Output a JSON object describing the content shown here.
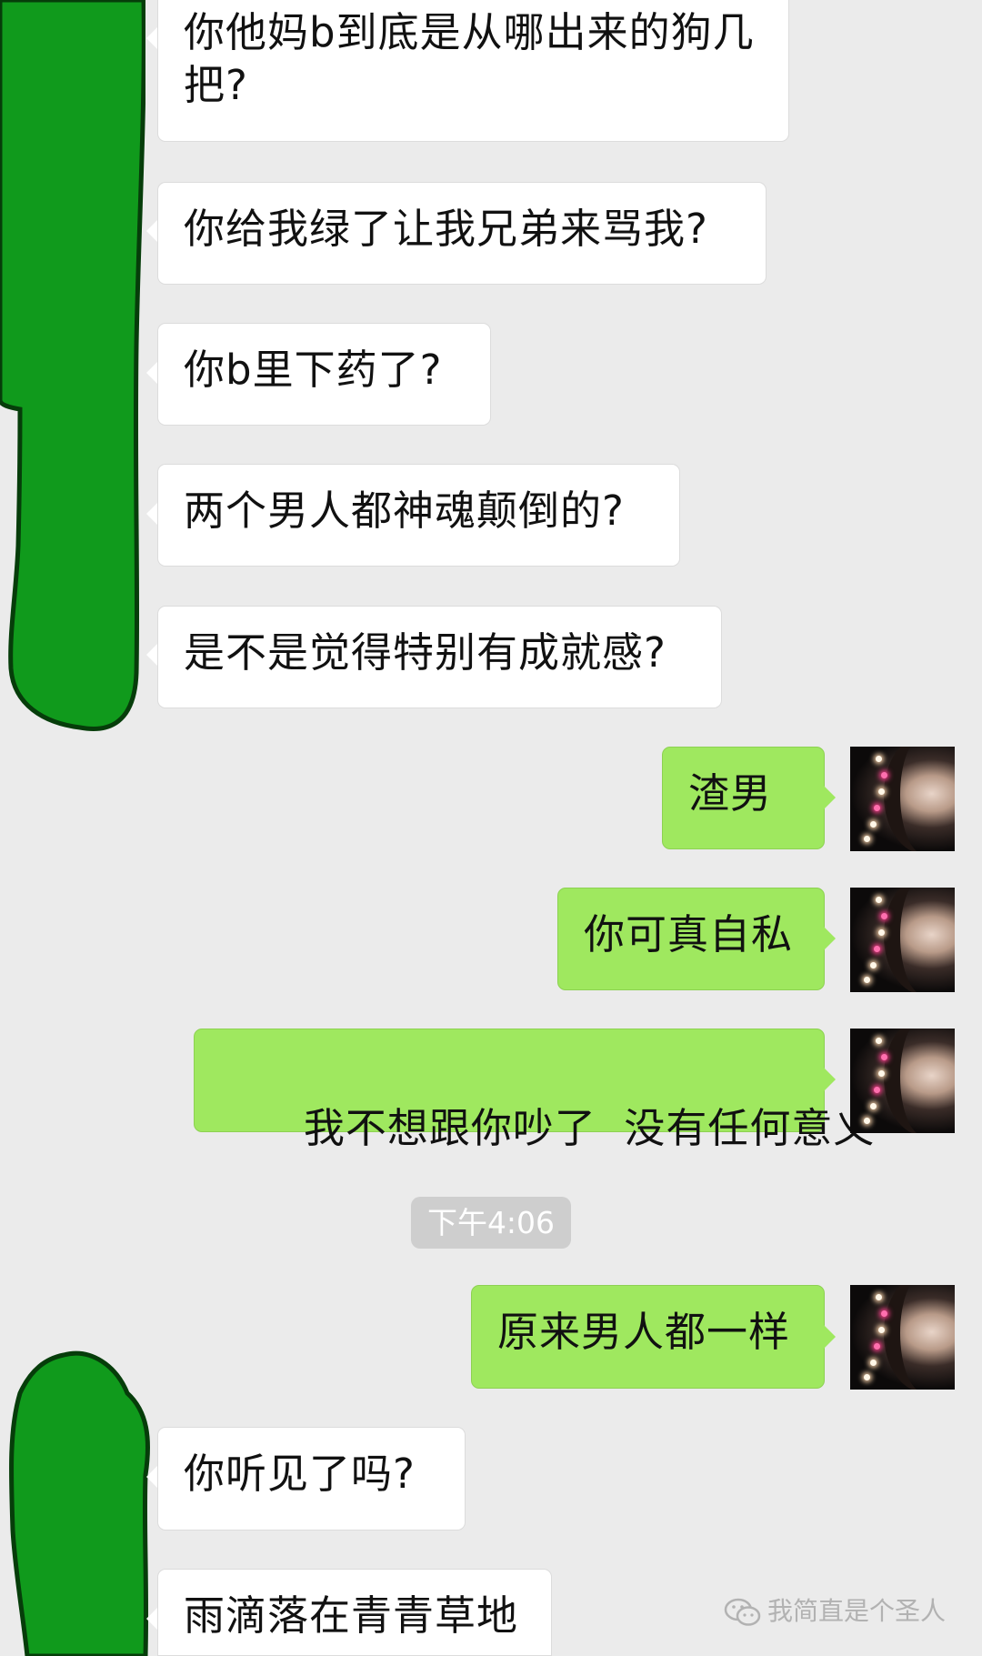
{
  "messages": [
    {
      "side": "in",
      "text": "你他妈b到底是从哪出来的狗几把?"
    },
    {
      "side": "in",
      "text": "你给我绿了让我兄弟来骂我?"
    },
    {
      "side": "in",
      "text": "你b里下药了?"
    },
    {
      "side": "in",
      "text": "两个男人都神魂颠倒的?"
    },
    {
      "side": "in",
      "text": "是不是觉得特别有成就感?"
    },
    {
      "side": "out",
      "text": "渣男"
    },
    {
      "side": "out",
      "text": "你可真自私"
    },
    {
      "side": "out",
      "text": "我不想跟你吵了  没有任何意义"
    },
    {
      "side": "out",
      "text": "原来男人都一样"
    },
    {
      "side": "in",
      "text": "你听见了吗?"
    },
    {
      "side": "in",
      "text": "雨滴落在青青草地"
    }
  ],
  "timestamp": "下午4:06",
  "watermark": {
    "text": "我简直是个圣人",
    "icon": "wechat-icon"
  },
  "colors": {
    "background": "#ebebeb",
    "incoming_bubble": "#ffffff",
    "outgoing_bubble": "#9fe85f",
    "redaction": "#109a1c",
    "timestamp_bg": "#cecece"
  },
  "avatar": {
    "icon": "user-avatar"
  }
}
